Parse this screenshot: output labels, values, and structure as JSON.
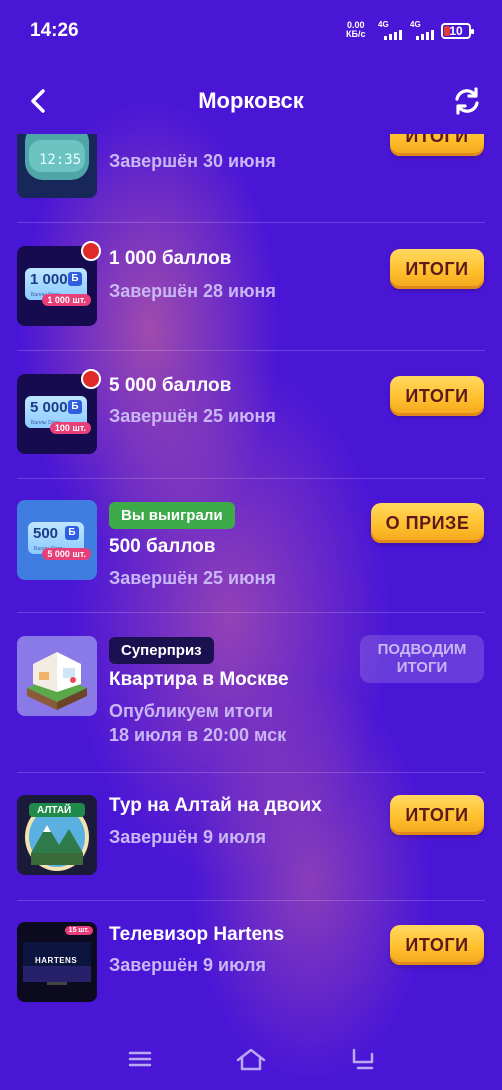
{
  "status_bar": {
    "time": "14:26",
    "net_speed_value": "0.00",
    "net_speed_unit": "КБ/с",
    "signal1_label": "4G",
    "signal2_label": "4G",
    "battery": "10"
  },
  "header": {
    "title": "Морковск"
  },
  "items": [
    {
      "name": "",
      "subtitle": "Завершён 30 июня",
      "button": "ИТОГИ",
      "thumb_text": "12:35"
    },
    {
      "name": "1 000 баллов",
      "subtitle": "Завершён 28 июня",
      "button": "ИТОГИ",
      "card_value": "1 000",
      "card_tag": "1 000 шт."
    },
    {
      "name": "5 000 баллов",
      "subtitle": "Завершён 25 июня",
      "button": "ИТОГИ",
      "card_value": "5 000",
      "card_tag": "100 шт."
    },
    {
      "name": "500 баллов",
      "subtitle": "Завершён 25 июня",
      "button": "О ПРИЗЕ",
      "badge": "Вы выиграли",
      "card_value": "500",
      "card_tag": "5 000 шт."
    },
    {
      "name": "Квартира в Москве",
      "subtitle_line1": "Опубликуем итоги",
      "subtitle_line2": "18 июля в 20:00 мск",
      "button_line1": "ПОДВОДИМ",
      "button_line2": "ИТОГИ",
      "badge": "Суперприз"
    },
    {
      "name": "Тур на Алтай на двоих",
      "subtitle": "Завершён 9 июля",
      "button": "ИТОГИ",
      "thumb_text": "АЛТАЙ"
    },
    {
      "name": "Телевизор Hartens",
      "subtitle": "Завершён 9 июля",
      "button": "ИТОГИ",
      "thumb_text": "HARTENS",
      "thumb_tag": "15 шт."
    }
  ],
  "colors": {
    "background": "#4a16d6",
    "button_gold": "#ffc02e",
    "badge_green": "#3dab4a",
    "notification_red": "#e02a2a"
  },
  "icons": [
    "back-icon",
    "refresh-icon",
    "menu-icon",
    "home-icon",
    "back-nav-icon"
  ]
}
